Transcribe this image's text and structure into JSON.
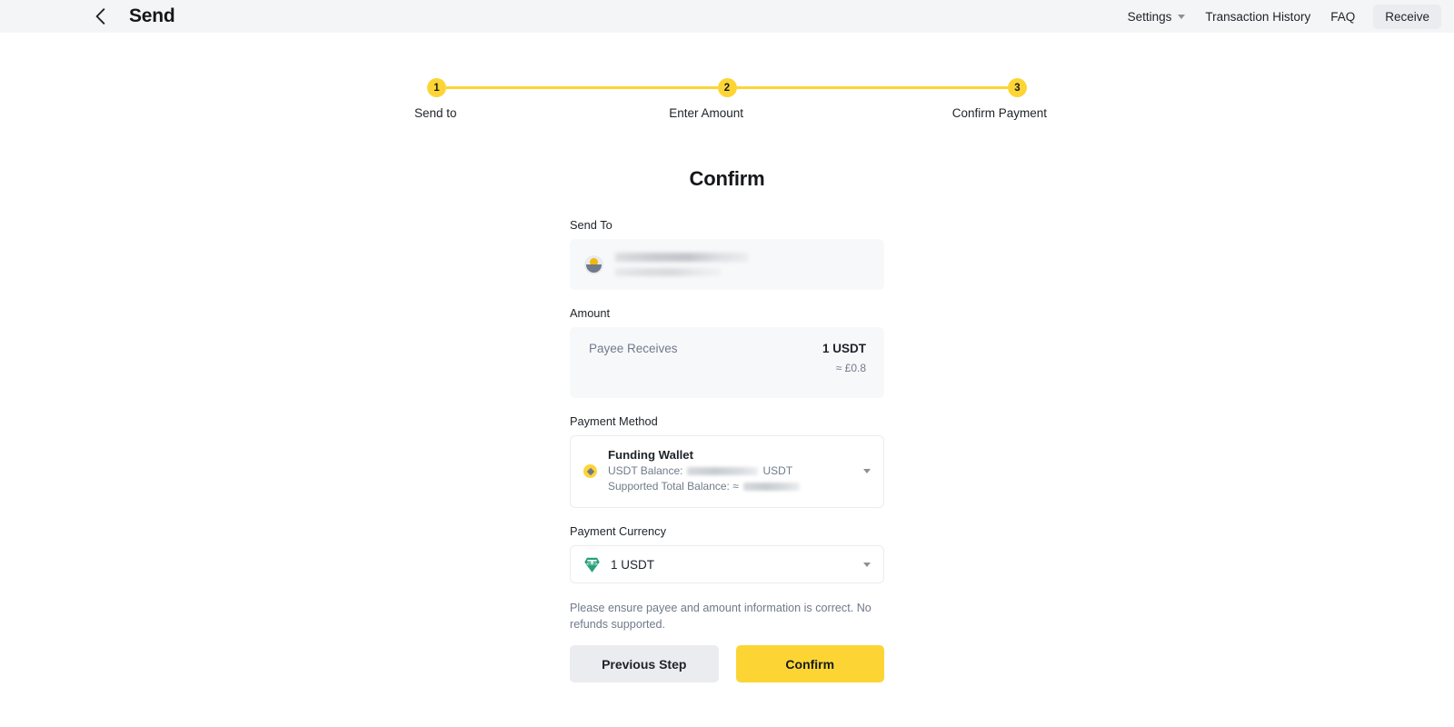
{
  "header": {
    "back_icon": "chevron-left-icon",
    "title": "Send",
    "nav": [
      {
        "label": "Settings",
        "has_caret": true
      },
      {
        "label": "Transaction History",
        "has_caret": false
      },
      {
        "label": "FAQ",
        "has_caret": false
      }
    ],
    "receive_label": "Receive"
  },
  "stepper": {
    "steps": [
      {
        "number": "1",
        "label": "Send to"
      },
      {
        "number": "2",
        "label": "Enter Amount"
      },
      {
        "number": "3",
        "label": "Confirm Payment"
      }
    ],
    "accent_color": "#FCD535"
  },
  "form": {
    "title": "Confirm",
    "send_to": {
      "label": "Send To",
      "avatar_icon": "user-avatar-icon",
      "value_redacted": true
    },
    "amount": {
      "label": "Amount",
      "row_label": "Payee Receives",
      "primary_value": "1 USDT",
      "secondary_value": "≈ £0.8"
    },
    "payment_method": {
      "label": "Payment Method",
      "selected": true,
      "wallet_name": "Funding Wallet",
      "balance_prefix": "USDT Balance:",
      "balance_suffix": "USDT",
      "balance_redacted": true,
      "total_prefix": "Supported Total Balance: ≈",
      "total_redacted": true,
      "chevron_icon": "chevron-down-icon"
    },
    "payment_currency": {
      "label": "Payment Currency",
      "currency_icon": "tether-usdt-icon",
      "currency_icon_color": "#26A17B",
      "value": "1 USDT",
      "chevron_icon": "chevron-down-icon"
    },
    "notice": "Please ensure payee and amount information is correct. No refunds supported.",
    "buttons": {
      "previous_label": "Previous Step",
      "confirm_label": "Confirm"
    }
  }
}
